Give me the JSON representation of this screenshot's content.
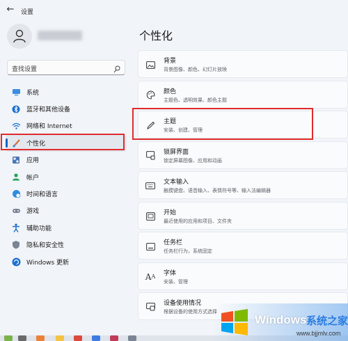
{
  "titlebar": {
    "back_icon": "back-arrow-icon",
    "title": "设置"
  },
  "search": {
    "placeholder": "查找设置"
  },
  "nav": [
    {
      "label": "系统",
      "icon": "system-icon",
      "active": false
    },
    {
      "label": "蓝牙和其他设备",
      "icon": "bluetooth-icon",
      "active": false
    },
    {
      "label": "网络和 Internet",
      "icon": "wifi-icon",
      "active": false
    },
    {
      "label": "个性化",
      "icon": "brush-icon",
      "active": true
    },
    {
      "label": "应用",
      "icon": "apps-icon",
      "active": false
    },
    {
      "label": "帐户",
      "icon": "account-icon",
      "active": false
    },
    {
      "label": "时间和语言",
      "icon": "globe-clock-icon",
      "active": false
    },
    {
      "label": "游戏",
      "icon": "gamepad-icon",
      "active": false
    },
    {
      "label": "辅助功能",
      "icon": "accessibility-icon",
      "active": false
    },
    {
      "label": "隐私和安全性",
      "icon": "shield-icon",
      "active": false
    },
    {
      "label": "Windows 更新",
      "icon": "update-icon",
      "active": false
    }
  ],
  "page_title": "个性化",
  "cards": [
    {
      "title": "背景",
      "subtitle": "背景图像、颜色、幻灯片放映",
      "icon": "picture-icon"
    },
    {
      "title": "颜色",
      "subtitle": "主题色、透明效果、颜色主题",
      "icon": "palette-icon"
    },
    {
      "title": "主题",
      "subtitle": "安装、创建、管理",
      "icon": "pen-icon"
    },
    {
      "title": "锁屏界面",
      "subtitle": "锁定屏幕图像、应用和动画",
      "icon": "lock-screen-icon"
    },
    {
      "title": "文本输入",
      "subtitle": "触摸键盘、语音输入、表情符号等、输入法编辑器",
      "icon": "keyboard-icon"
    },
    {
      "title": "开始",
      "subtitle": "最近使用的应用和项目、文件夹",
      "icon": "start-icon"
    },
    {
      "title": "任务栏",
      "subtitle": "任务栏行为，系统固定",
      "icon": "taskbar-icon"
    },
    {
      "title": "字体",
      "subtitle": "安装、管理",
      "icon": "font-icon"
    },
    {
      "title": "设备使用情况",
      "subtitle": "根据设备的使用方式选择",
      "icon": "device-usage-icon"
    }
  ],
  "watermark": {
    "brand": "Windows",
    "cn": "系统之家",
    "url": "www.bjjmlv.com"
  },
  "colors": {
    "accent": "#1a63c6",
    "highlight": "#e02b2b"
  }
}
